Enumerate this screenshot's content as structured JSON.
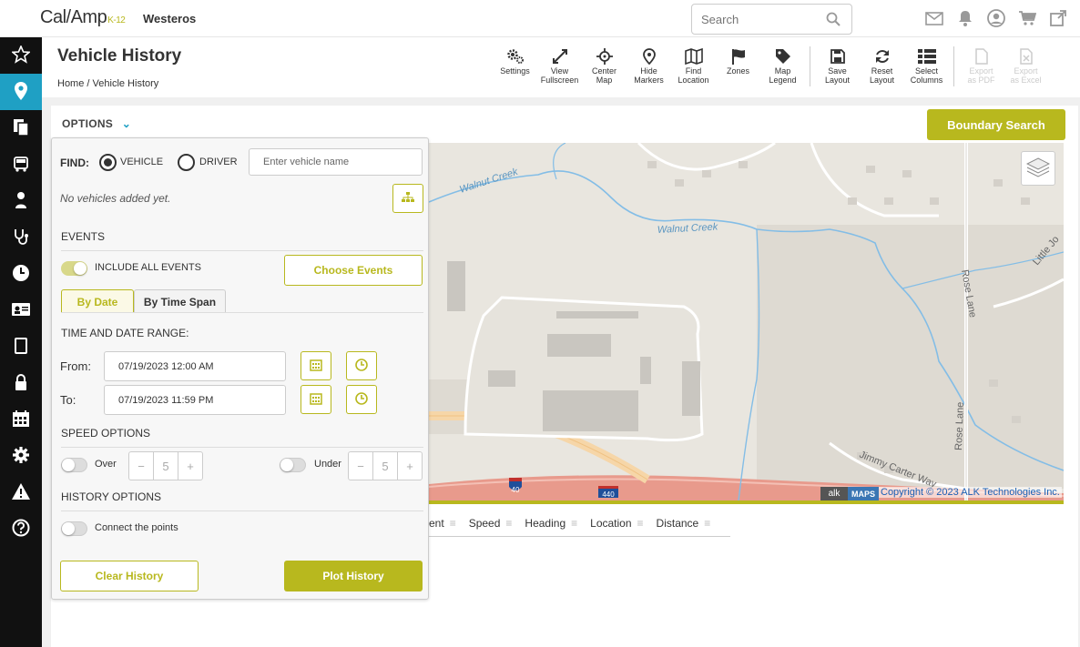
{
  "app": {
    "logo": "Cal/Amp",
    "logo_sub": "K-12",
    "org": "Westeros"
  },
  "search": {
    "placeholder": "Search"
  },
  "page": {
    "title": "Vehicle History",
    "breadcrumb_home": "Home",
    "breadcrumb_sep": "/",
    "breadcrumb_current": "Vehicle History"
  },
  "toolbar": [
    {
      "l1": "Settings",
      "l2": ""
    },
    {
      "l1": "View",
      "l2": "Fullscreen"
    },
    {
      "l1": "Center",
      "l2": "Map"
    },
    {
      "l1": "Hide",
      "l2": "Markers"
    },
    {
      "l1": "Find",
      "l2": "Location"
    },
    {
      "l1": "Zones",
      "l2": ""
    },
    {
      "l1": "Map",
      "l2": "Legend"
    },
    {
      "l1": "Save",
      "l2": "Layout"
    },
    {
      "l1": "Reset",
      "l2": "Layout"
    },
    {
      "l1": "Select",
      "l2": "Columns"
    },
    {
      "l1": "Export",
      "l2": "as PDF"
    },
    {
      "l1": "Export",
      "l2": "as Excel"
    }
  ],
  "options": {
    "label": "OPTIONS"
  },
  "boundary_search": "Boundary Search",
  "find": {
    "label": "FIND:",
    "vehicle": "VEHICLE",
    "driver": "DRIVER",
    "placeholder": "Enter vehicle name",
    "empty": "No vehicles added yet."
  },
  "events": {
    "title": "EVENTS",
    "include_all": "INCLUDE ALL EVENTS",
    "choose": "Choose Events"
  },
  "tabs": {
    "by_date": "By Date",
    "by_span": "By Time Span"
  },
  "range": {
    "title": "TIME AND DATE RANGE:",
    "from_label": "From:",
    "from_value": "07/19/2023 12:00 AM",
    "to_label": "To:",
    "to_value": "07/19/2023 11:59 PM"
  },
  "speed": {
    "title": "SPEED OPTIONS",
    "over": "Over",
    "over_value": "5",
    "under": "Under",
    "under_value": "5"
  },
  "history": {
    "title": "HISTORY OPTIONS",
    "connect": "Connect the points"
  },
  "actions": {
    "clear": "Clear History",
    "plot": "Plot History"
  },
  "columns": [
    "ent",
    "Speed",
    "Heading",
    "Location",
    "Distance"
  ],
  "map": {
    "labels": {
      "walnut1": "Walnut Creek",
      "walnut2": "Walnut Creek",
      "rose": "Rose Lane",
      "jimmy": "Jimmy Carter Way",
      "little": "Little Jo",
      "rose2": "Rose Lane",
      "i40": "40",
      "i440": "440"
    },
    "alk": "alk",
    "maps": "MAPS",
    "copyright": "Copyright © 2023 ALK Technologies Inc."
  },
  "colors": {
    "accent": "#b8b81e",
    "sidebar": "#111111",
    "active": "#1fa0c4"
  }
}
